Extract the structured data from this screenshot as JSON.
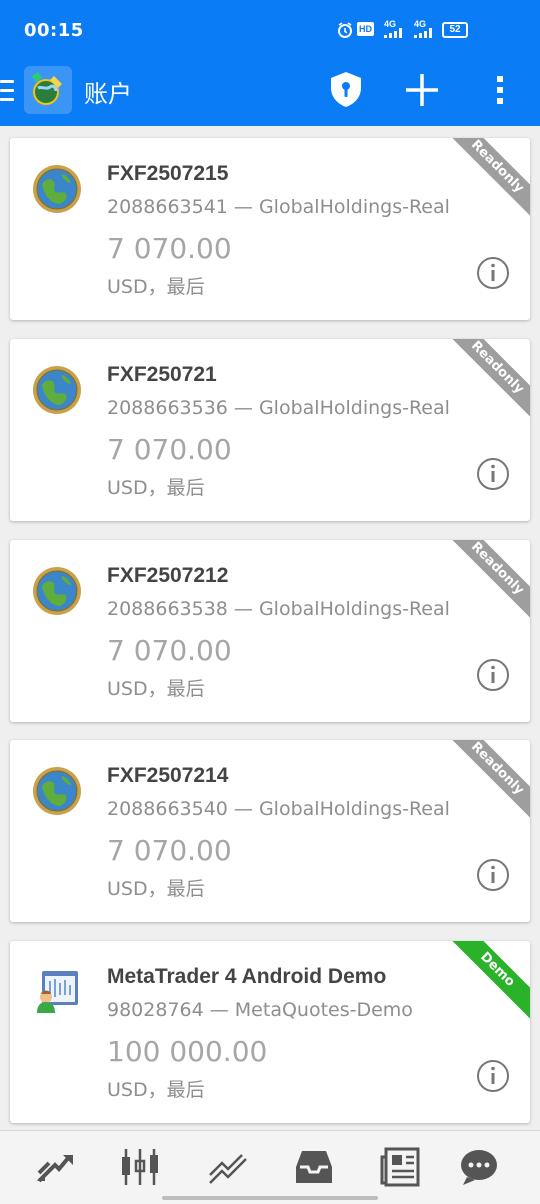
{
  "status_bar": {
    "time": "00:15",
    "battery": "52",
    "network_1": "4G",
    "network_2": "4G",
    "hd": "HD"
  },
  "app_bar": {
    "title": "账户",
    "accent_color": "#0a7cf5"
  },
  "accounts": [
    {
      "name": "FXF2507215",
      "server": "2088663541 — GlobalHoldings-Real",
      "balance": "7 070.00",
      "currency": "USD，最后",
      "badge": "Readonly",
      "badge_color": "#9e9e9e",
      "avatar_icon": "globe-icon"
    },
    {
      "name": "FXF250721",
      "server": "2088663536 — GlobalHoldings-Real",
      "balance": "7 070.00",
      "currency": "USD，最后",
      "badge": "Readonly",
      "badge_color": "#9e9e9e",
      "avatar_icon": "globe-icon"
    },
    {
      "name": "FXF2507212",
      "server": "2088663538 — GlobalHoldings-Real",
      "balance": "7 070.00",
      "currency": "USD，最后",
      "badge": "Readonly",
      "badge_color": "#9e9e9e",
      "avatar_icon": "globe-icon"
    },
    {
      "name": "FXF2507214",
      "server": "2088663540 — GlobalHoldings-Real",
      "balance": "7 070.00",
      "currency": "USD，最后",
      "badge": "Readonly",
      "badge_color": "#9e9e9e",
      "avatar_icon": "globe-icon"
    },
    {
      "name": "MetaTrader 4 Android Demo",
      "server": "98028764 — MetaQuotes-Demo",
      "balance": "100 000.00",
      "currency": "USD，最后",
      "badge": "Demo",
      "badge_color": "#2ab32a",
      "avatar_icon": "metaquotes-demo-icon"
    }
  ],
  "bottom_nav": [
    {
      "name": "quotes",
      "icon": "quotes-arrows-icon"
    },
    {
      "name": "chart",
      "icon": "candlestick-icon"
    },
    {
      "name": "trade",
      "icon": "trend-icon"
    },
    {
      "name": "history",
      "icon": "inbox-icon"
    },
    {
      "name": "news",
      "icon": "news-icon"
    },
    {
      "name": "chat",
      "icon": "chat-icon"
    }
  ]
}
